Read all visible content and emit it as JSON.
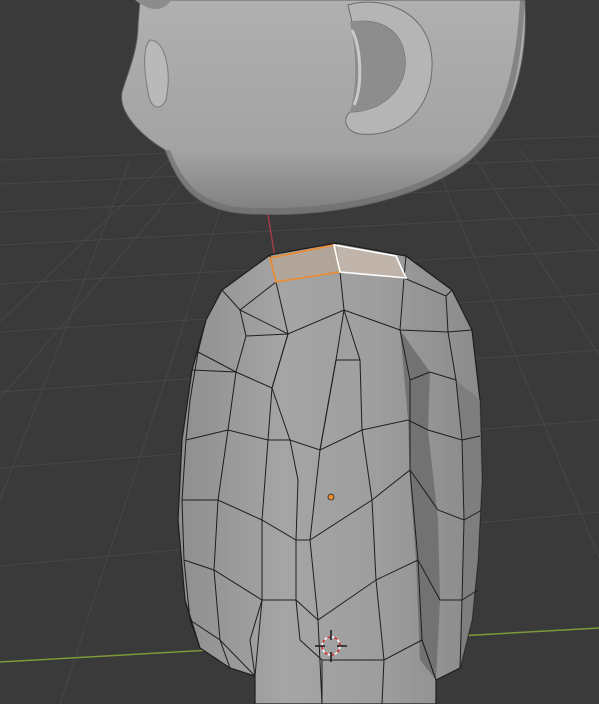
{
  "app": "3D viewport",
  "viewport": {
    "mode": "edit-mesh",
    "colors": {
      "background": "#3a3a3a",
      "grid": "#474747",
      "x_axis": "#7d9a39",
      "y_axis": "#b63a4b",
      "mesh_face": "#9c9c9c",
      "mesh_edge": "#1e1e1e",
      "selected_face": "#b7a596",
      "active_face": "#c7b8ad",
      "selected_edge": "#f08a2a",
      "active_edge": "#ffffff",
      "head_surface": "#a7a7a7"
    }
  },
  "objects": [
    {
      "name": "head-mesh",
      "state": "unselected"
    },
    {
      "name": "body-mesh",
      "state": "edit",
      "selected_faces": 2
    }
  ],
  "overlays": {
    "origin_point": "orange-dot",
    "cursor_3d": "crosshair-circle"
  }
}
